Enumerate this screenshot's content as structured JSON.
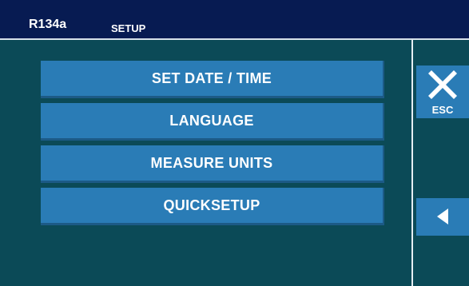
{
  "header": {
    "model": "R134a",
    "title": "SETUP"
  },
  "menu": {
    "items": [
      {
        "label": "SET DATE / TIME"
      },
      {
        "label": "LANGUAGE"
      },
      {
        "label": "MEASURE UNITS"
      },
      {
        "label": "QUICKSETUP"
      }
    ]
  },
  "side": {
    "esc_label": "ESC",
    "esc_icon": "close-icon",
    "back_icon": "arrow-left-icon"
  },
  "colors": {
    "header_bg": "#071b52",
    "body_bg": "#0b4a57",
    "button_bg": "#2a7cb6"
  }
}
